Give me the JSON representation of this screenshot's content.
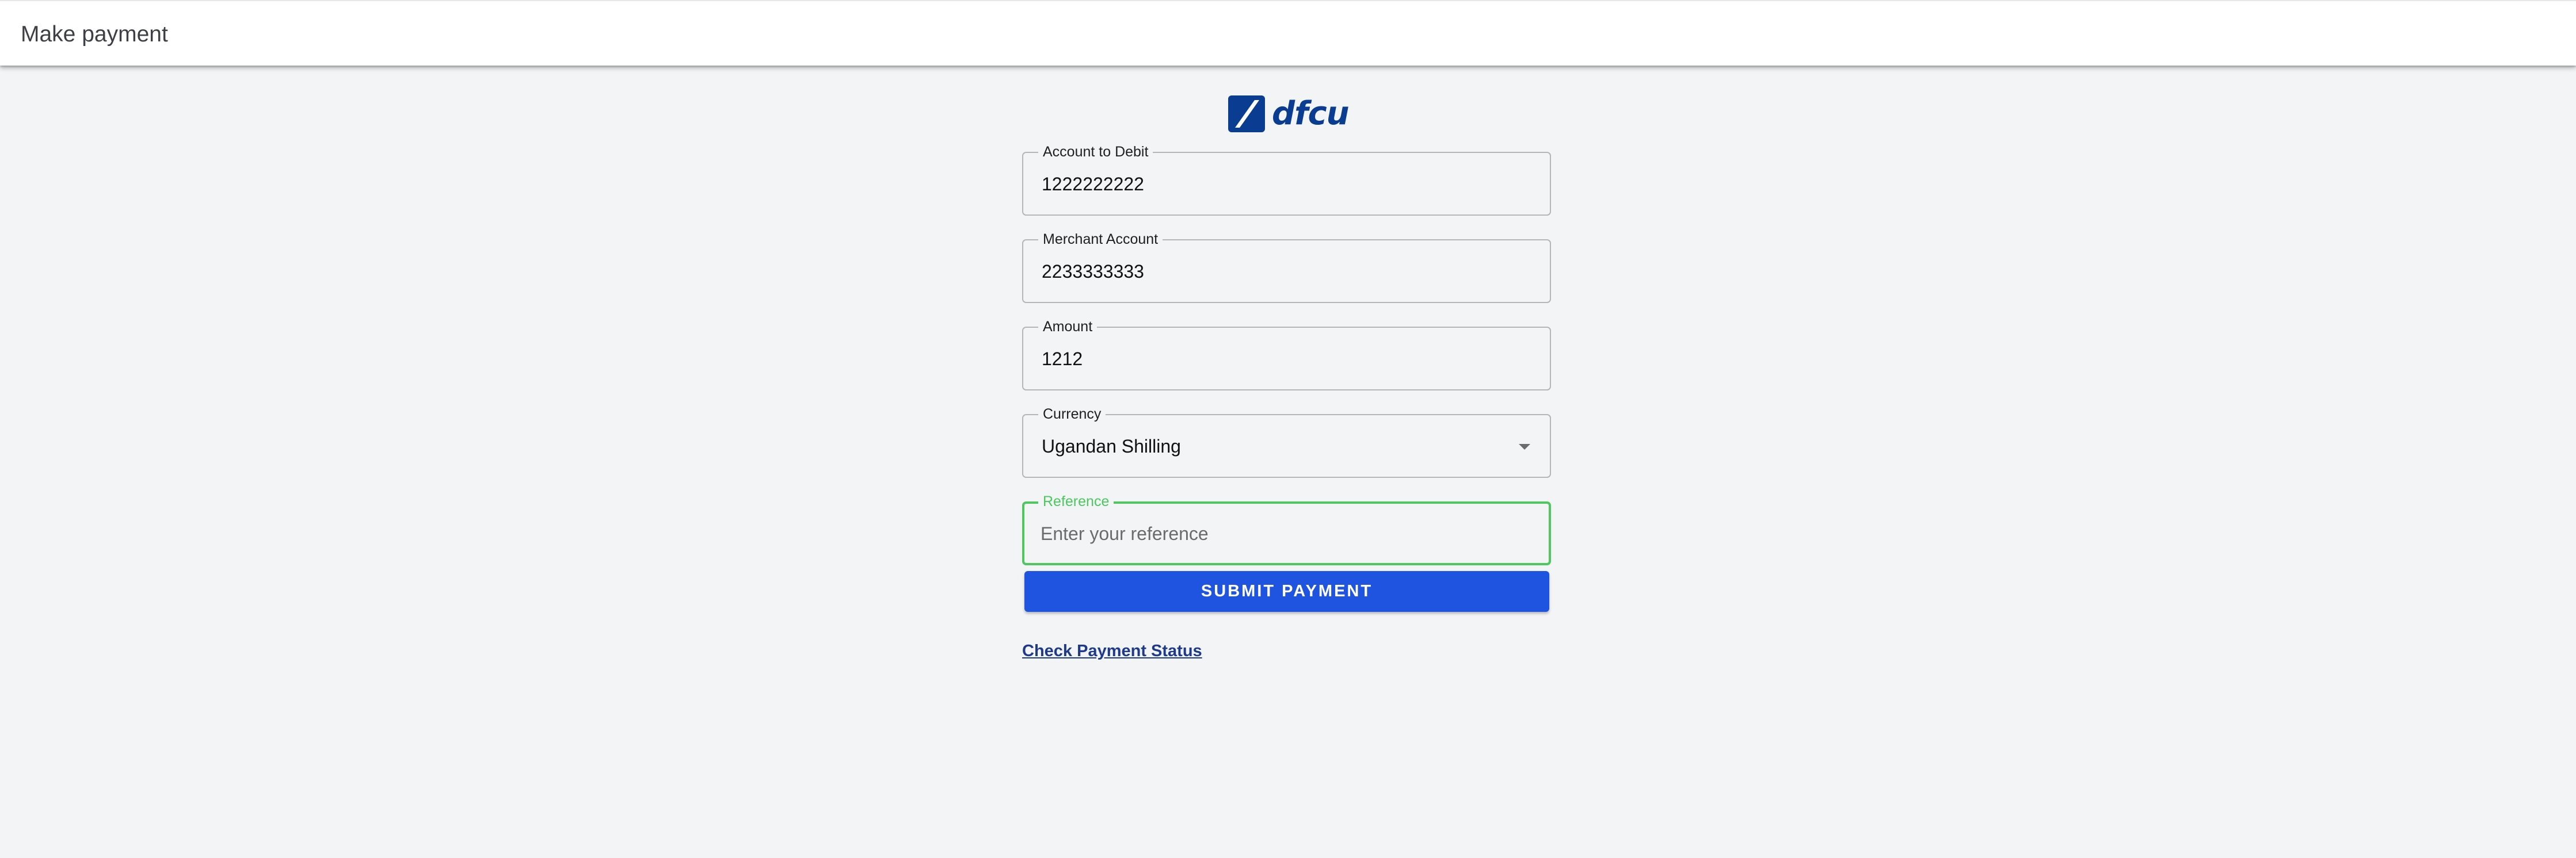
{
  "header": {
    "title": "Make payment"
  },
  "brand": {
    "logo_text": "dfcu",
    "logo_icon": "slash-square-icon",
    "color": "#0a3d91"
  },
  "form": {
    "account_to_debit": {
      "label": "Account to Debit",
      "value": "1222222222"
    },
    "merchant_account": {
      "label": "Merchant Account",
      "value": "2233333333"
    },
    "amount": {
      "label": "Amount",
      "value": "1212"
    },
    "currency": {
      "label": "Currency",
      "value": "Ugandan Shilling",
      "icon": "caret-down-icon"
    },
    "reference": {
      "label": "Reference",
      "value": "",
      "placeholder": "Enter your reference",
      "focus_color": "#4cc85f"
    },
    "submit_label": "Submit Payment",
    "submit_color": "#1f54e0"
  },
  "links": {
    "check_status": "Check Payment Status"
  }
}
